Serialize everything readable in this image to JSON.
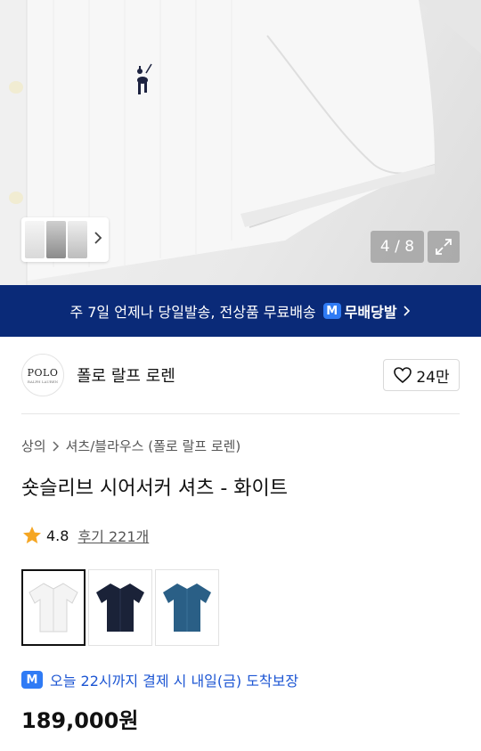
{
  "gallery": {
    "counter": "4 / 8"
  },
  "banner": {
    "text": "주 7일 언제나 당일발송, 전상품 무료배송",
    "badge_letter": "M",
    "brand": "무배당발"
  },
  "store": {
    "logo_text": "POLO",
    "logo_subtext": "RALPH LAUREN",
    "name": "폴로 랄프 로렌",
    "likes": "24만"
  },
  "breadcrumb": {
    "category": "상의",
    "subcategory": "셔츠/블라우스 (폴로 랄프 로렌)"
  },
  "product": {
    "title": "숏슬리브 시어서커 셔츠 - 화이트",
    "rating": "4.8",
    "reviews": "후기 221개",
    "price": "189,000원"
  },
  "variants": [
    {
      "color": "#f4f4f4",
      "selected": true
    },
    {
      "color": "#1a2238",
      "selected": false
    },
    {
      "color": "#2a5f86",
      "selected": false
    }
  ],
  "delivery": {
    "badge_letter": "M",
    "text": "오늘 22시까지 결제 시 내일(금) 도착보장"
  },
  "colors": {
    "banner_bg": "#0a2a78",
    "accent_blue": "#2f7bf5",
    "delivery_text": "#1d56d3",
    "star": "#f5a623"
  }
}
